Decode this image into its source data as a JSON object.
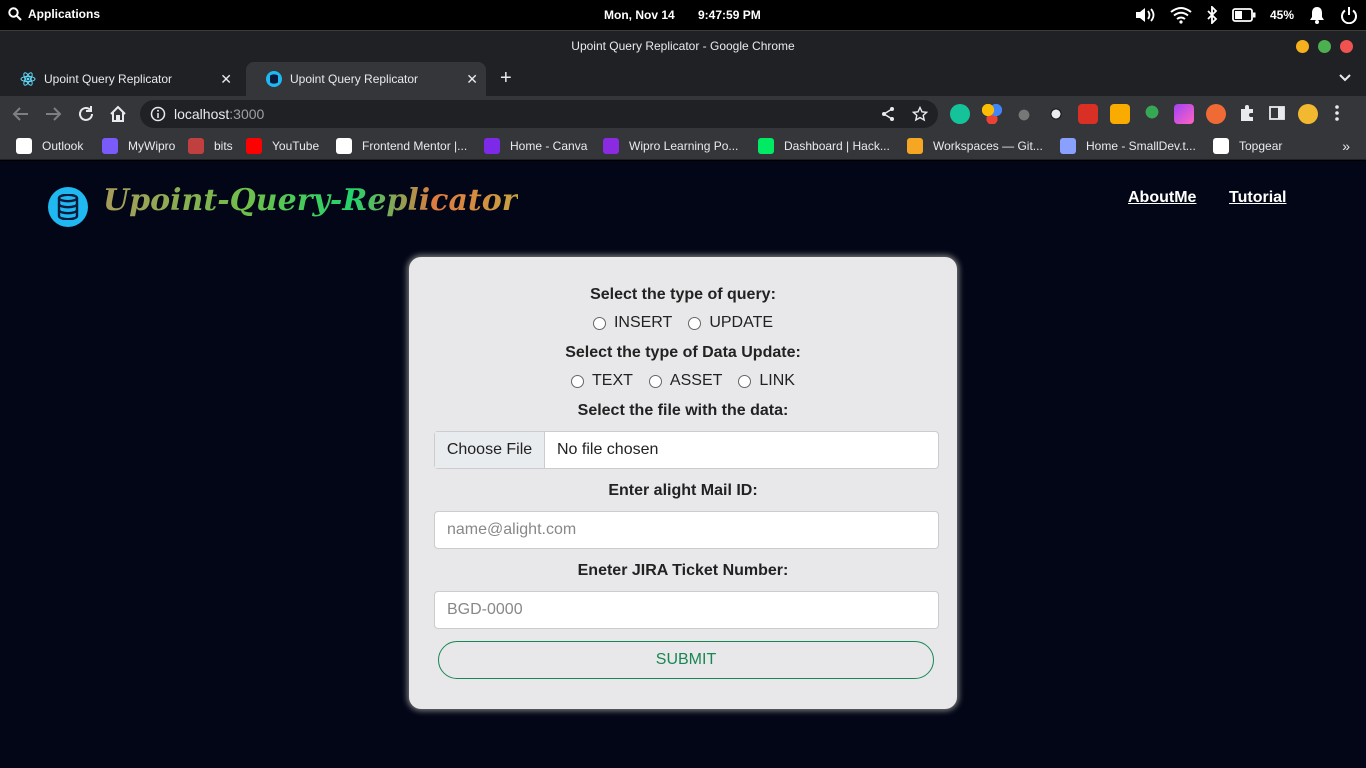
{
  "os": {
    "applications_label": "Applications",
    "date": "Mon, Nov 14",
    "time": "9:47:59 PM",
    "battery": "45%"
  },
  "window": {
    "title": "Upoint Query Replicator - Google Chrome"
  },
  "tabs": [
    {
      "label": "Upoint Query Replicator",
      "icon": "react-icon"
    },
    {
      "label": "Upoint Query Replicator",
      "icon": "database-icon"
    }
  ],
  "address": {
    "host": "localhost",
    "port": ":3000"
  },
  "bookmarks": [
    {
      "label": "Outlook",
      "color": "#ffffff"
    },
    {
      "label": "MyWipro",
      "color": "#7a5af8"
    },
    {
      "label": "bits",
      "color": "#c04040"
    },
    {
      "label": "YouTube",
      "color": "#ff0000"
    },
    {
      "label": "Frontend Mentor |...",
      "color": "#ffffff"
    },
    {
      "label": "Home - Canva",
      "color": "#7d2ae8"
    },
    {
      "label": "Wipro Learning Po...",
      "color": "#8a2be2"
    },
    {
      "label": "Dashboard | Hack...",
      "color": "#00ea64"
    },
    {
      "label": "Workspaces — Git...",
      "color": "#f5a623"
    },
    {
      "label": "Home - SmallDev.t...",
      "color": "#8aa0ff"
    },
    {
      "label": "Topgear",
      "color": "#ffffff"
    }
  ],
  "header": {
    "brand": "Upoint-Query-Replicator",
    "nav": [
      "AboutMe",
      "Tutorial"
    ]
  },
  "form": {
    "query_type_label": "Select the type of query:",
    "query_types": [
      "INSERT",
      "UPDATE"
    ],
    "data_type_label": "Select the type of Data Update:",
    "data_types": [
      "TEXT",
      "ASSET",
      "LINK"
    ],
    "file_label": "Select the file with the data:",
    "file_button": "Choose File",
    "file_status": "No file chosen",
    "mail_label": "Enter alight Mail ID:",
    "mail_placeholder": "name@alight.com",
    "jira_label": "Eneter JIRA Ticket Number:",
    "jira_placeholder": "BGD-0000",
    "submit_label": "SUBMIT"
  },
  "colors": {
    "page_bg": "#020617",
    "card_bg": "#e8e8ea",
    "submit_accent": "#198754"
  }
}
